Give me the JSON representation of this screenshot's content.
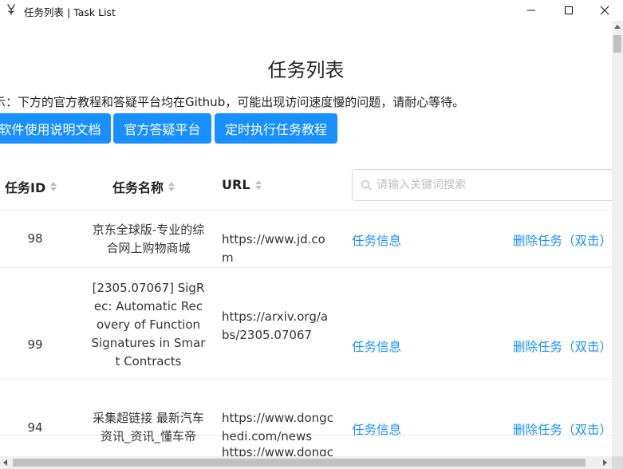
{
  "window": {
    "title": "任务列表 | Task List",
    "icon": "app-logo-icon"
  },
  "page": {
    "heading": "任务列表",
    "notice": "示：下方的官方教程和答疑平台均在Github，可能出现访问速度慢的问题，请耐心等待。",
    "buttons": [
      "软件使用说明文档",
      "官方答疑平台",
      "定时执行任务教程"
    ]
  },
  "table": {
    "columns": [
      "任务ID",
      "任务名称",
      "URL"
    ],
    "search": {
      "placeholder": "请输入关键词搜索",
      "value": ""
    },
    "actions": {
      "info": "任务信息",
      "delete": "删除任务（双击）"
    },
    "rows": [
      {
        "id": "98",
        "name": "京东全球版-专业的综合网上购物商城",
        "url": "https://www.jd.com"
      },
      {
        "id": "99",
        "name": "[2305.07067] SigRec: Automatic Recovery of Function Signatures in Smart Contracts",
        "url": "https://arxiv.org/abs/2305.07067"
      },
      {
        "id": "94",
        "name": "采集超链接 最新汽车资讯_资讯_懂车帝",
        "url": "https://www.dongchedi.com/news"
      },
      {
        "id": "",
        "name": "",
        "url": "https://www.dongc"
      }
    ]
  },
  "colors": {
    "primary": "#1890ff",
    "link": "#1890ff",
    "border": "#ececec"
  }
}
